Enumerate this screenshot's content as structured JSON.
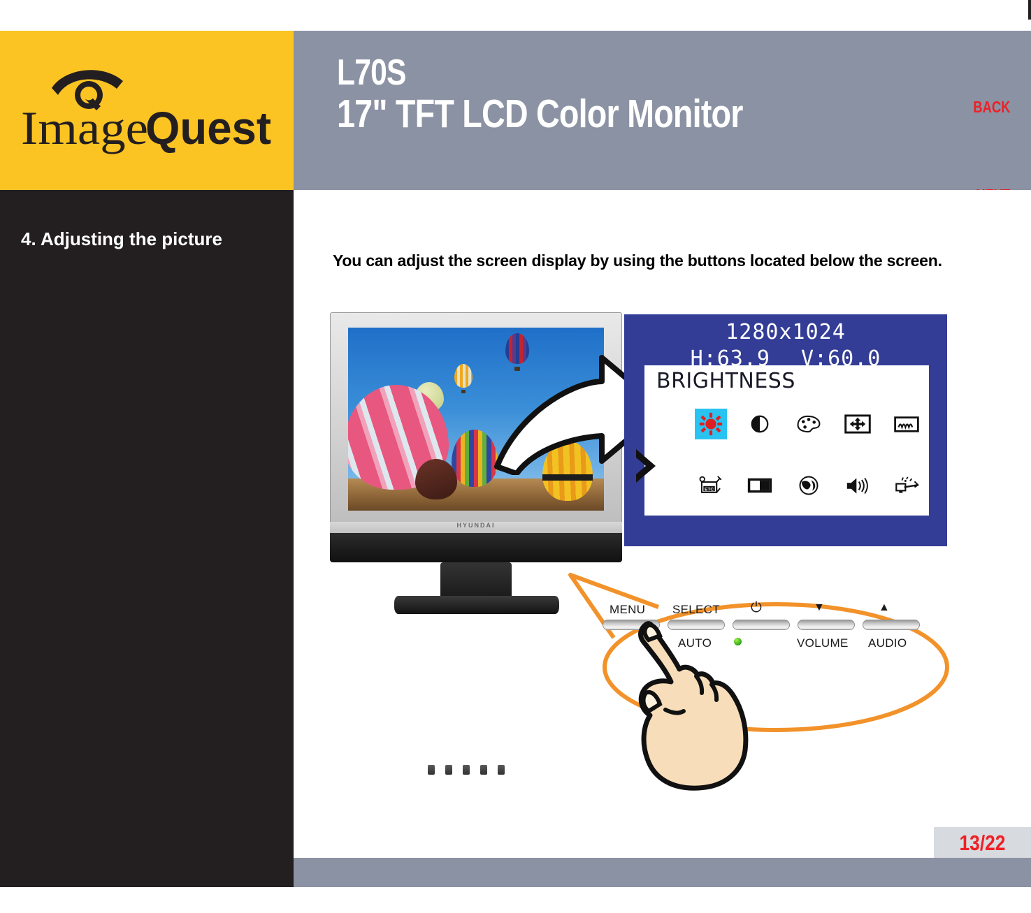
{
  "header": {
    "model": "L70S",
    "subtitle": "17\" TFT LCD Color Monitor",
    "back_label": "BACK",
    "next_label": "NEXT",
    "bg_color": "#8b92a3",
    "link_color": "#ee2026"
  },
  "logo": {
    "brand_light": "Image",
    "brand_bold": "Quest",
    "bg_color": "#fcc423",
    "ink_color": "#231f20"
  },
  "sidebar": {
    "section_title": "4. Adjusting the picture",
    "bg_color": "#231f20"
  },
  "main": {
    "intro_text": "You can adjust the screen display by using the buttons located below the screen.",
    "monitor_brand": "HYUNDAI"
  },
  "osd": {
    "resolution": "1280x1024",
    "h_freq": "H:63.9",
    "v_freq": "V:60.0",
    "selected_label": "BRIGHTNESS",
    "bg_color": "#333d96",
    "highlight_color": "#29c3f2",
    "icon_rows": [
      [
        {
          "name": "brightness-icon",
          "selected": true
        },
        {
          "name": "contrast-icon",
          "selected": false
        },
        {
          "name": "color-palette-icon",
          "selected": false
        },
        {
          "name": "h-v-position-icon",
          "selected": false
        },
        {
          "name": "clock-phase-icon",
          "selected": false
        }
      ],
      [
        {
          "name": "etc-icon",
          "selected": false
        },
        {
          "name": "osd-position-icon",
          "selected": false
        },
        {
          "name": "language-globe-icon",
          "selected": false
        },
        {
          "name": "volume-speaker-icon",
          "selected": false
        },
        {
          "name": "auto-adjust-icon",
          "selected": false
        }
      ]
    ]
  },
  "control_panel": {
    "top_labels": [
      "MENU",
      "SELECT",
      "power-symbol",
      "▼",
      "▲"
    ],
    "bottom_labels": [
      "AUTO",
      "led-indicator",
      "VOLUME",
      "AUDIO"
    ],
    "menu_label": "MENU",
    "select_label": "SELECT",
    "power_label": "⏻",
    "down_label": "▼",
    "up_label": "▲",
    "auto_label": "AUTO",
    "volume_label": "VOLUME",
    "audio_label": "AUDIO",
    "callout_color": "#f2922a",
    "led_color": "#3fbd1c"
  },
  "footer": {
    "page_number": "13/22",
    "page_box_color": "#d7dbe0",
    "bar_color": "#8b92a3"
  }
}
